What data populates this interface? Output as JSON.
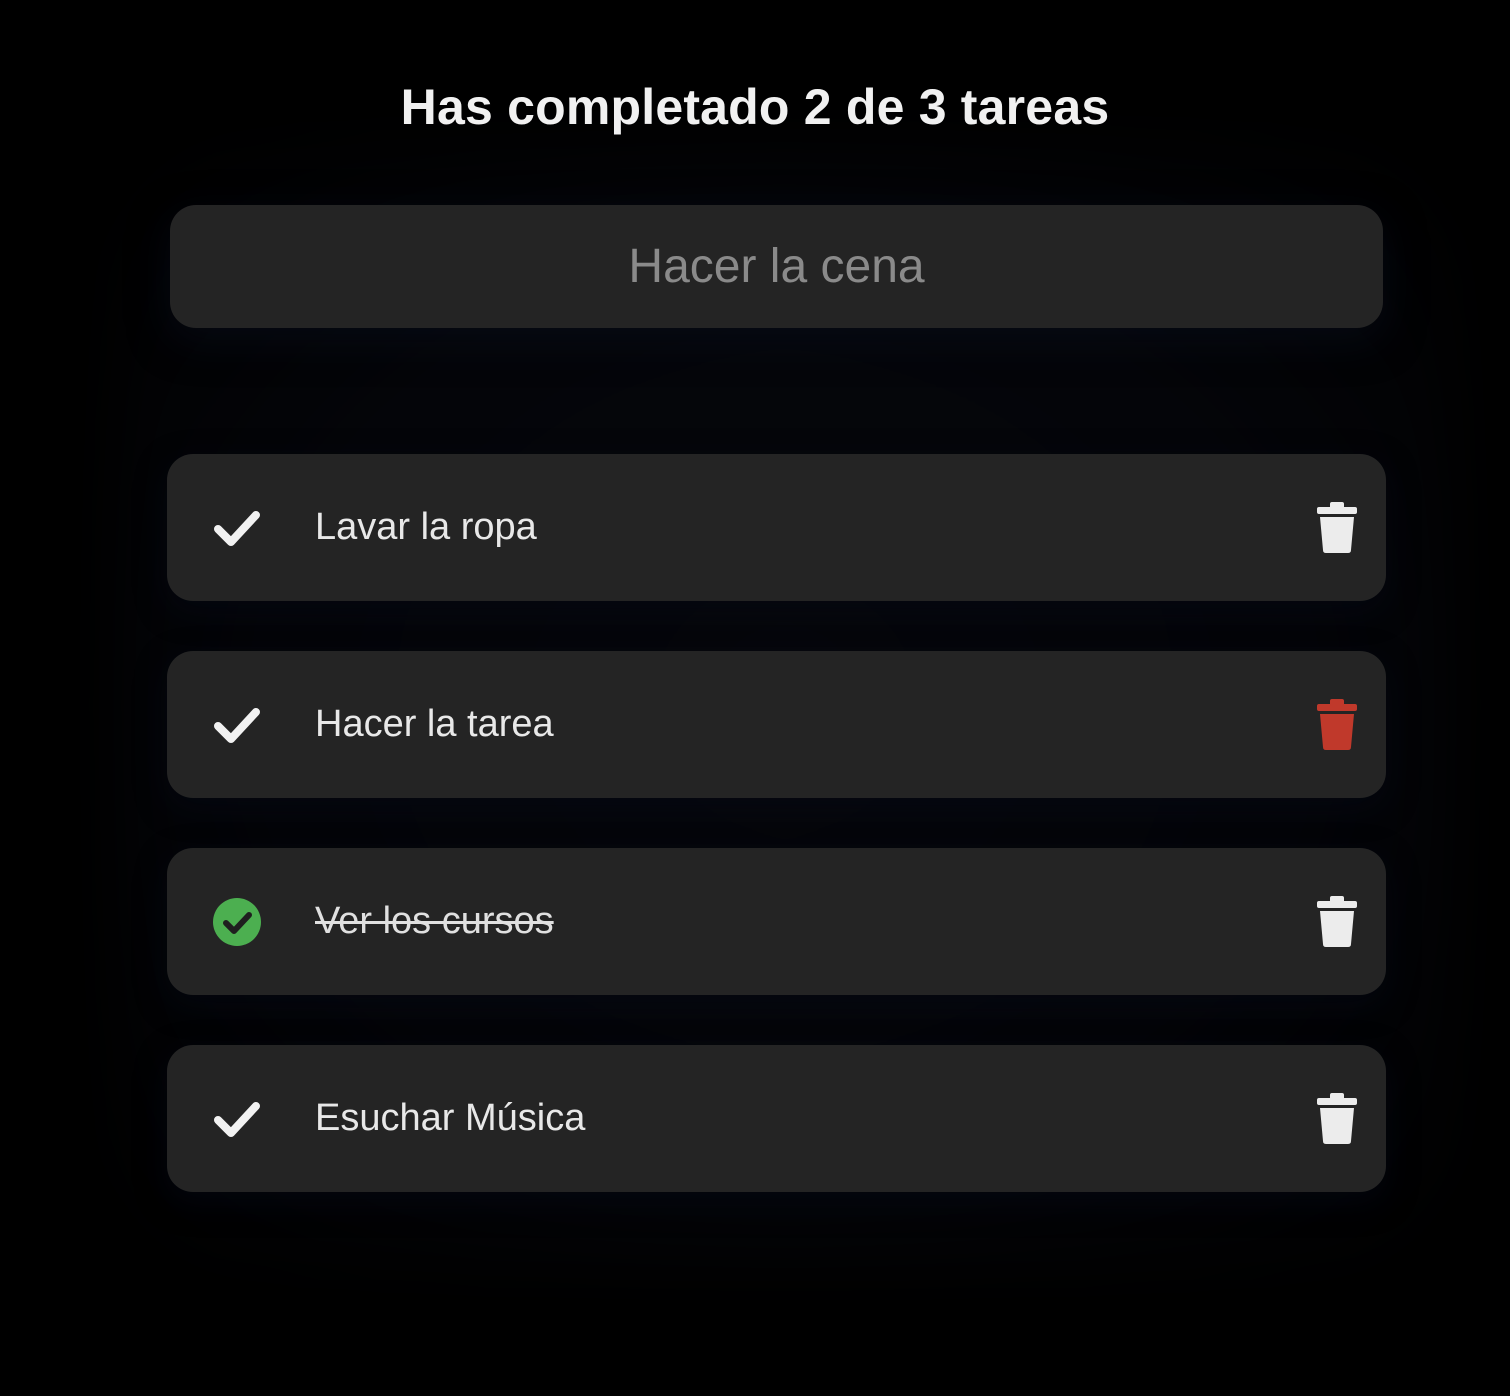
{
  "header": {
    "title": "Has completado 2 de 3 tareas"
  },
  "new_task": {
    "placeholder": "Hacer la cena",
    "value": ""
  },
  "colors": {
    "background": "#000000",
    "card": "#242424",
    "text": "#e8e8e8",
    "completed_check": "#4caf50",
    "delete_hover": "#c0392b"
  },
  "tasks": [
    {
      "text": "Lavar la ropa",
      "completed": false,
      "check_icon": "check-icon",
      "delete_icon": "trash-icon"
    },
    {
      "text": "Hacer la tarea",
      "completed": false,
      "check_icon": "check-icon",
      "delete_icon": "trash-icon-hover"
    },
    {
      "text": "Ver los cursos",
      "completed": true,
      "check_icon": "check-circle-icon",
      "delete_icon": "trash-icon"
    },
    {
      "text": "Esuchar Música",
      "completed": false,
      "check_icon": "check-icon",
      "delete_icon": "trash-icon"
    }
  ]
}
